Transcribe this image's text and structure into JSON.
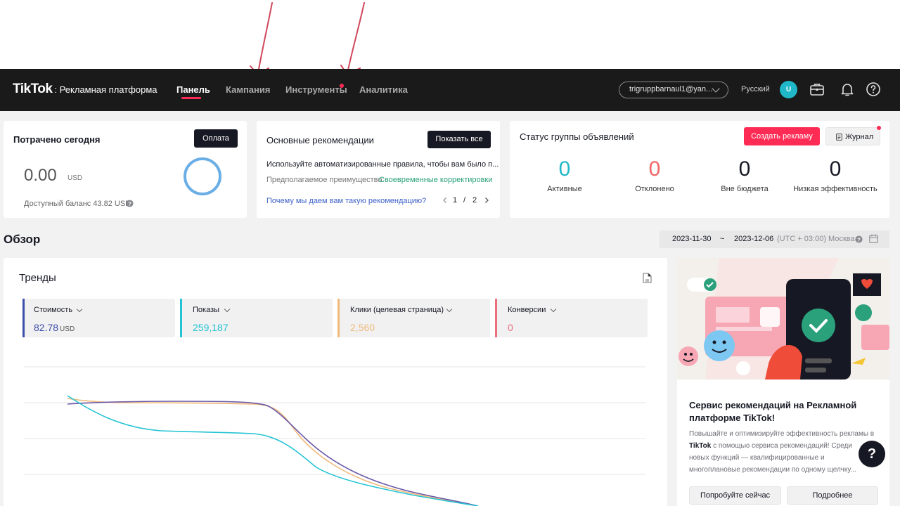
{
  "header": {
    "logo": "TikTok",
    "logo_sub": ": Рекламная платформа",
    "nav": [
      {
        "label": "Панель",
        "active": true
      },
      {
        "label": "Кампания",
        "active": false
      },
      {
        "label": "Инструменты",
        "active": false
      },
      {
        "label": "Аналитика",
        "active": false
      }
    ],
    "email": "trigruppbarnaul1@yan...",
    "language": "Русский",
    "avatar_letter": "U",
    "icons": [
      "briefcase-icon",
      "bell-icon",
      "help-icon"
    ]
  },
  "spent_card": {
    "title": "Потрачено сегодня",
    "pay_button": "Оплата",
    "amount": "0.00",
    "currency": "USD",
    "balance_text": "Доступный баланс 43.82 USD"
  },
  "recommendations": {
    "title": "Основные рекомендации",
    "show_all": "Показать все",
    "text": "Используйте автоматизированные правила, чтобы вам было п...",
    "benefit_label": "Предполагаемое преимущество:",
    "benefit_value": "Своевременные корректировки",
    "why_link": "Почему мы даем вам такую рекомендацию?",
    "page_current": "1",
    "page_sep": "/",
    "page_total": "2"
  },
  "adgroup_status": {
    "title": "Статус группы объявлений",
    "create_button": "Создать рекламу",
    "journal_button": "Журнал",
    "stats": [
      {
        "value": "0",
        "label": "Активные",
        "color": "#20b8c8"
      },
      {
        "value": "0",
        "label": "Отклонено",
        "color": "#f16464"
      },
      {
        "value": "0",
        "label": "Вне бюджета",
        "color": "#161823"
      },
      {
        "value": "0",
        "label": "Низкая эффективность",
        "color": "#161823"
      }
    ]
  },
  "overview": {
    "title": "Обзор",
    "date_from": "2023-11-30",
    "date_sep": "~",
    "date_to": "2023-12-06",
    "timezone": "(UTC + 03:00) Москва"
  },
  "trends": {
    "title": "Тренды",
    "metrics": [
      {
        "label": "Стоимость",
        "value": "82.78",
        "unit": "USD",
        "color": "#3d4fa8"
      },
      {
        "label": "Показы",
        "value": "259,187",
        "unit": "",
        "color": "#25c4d4"
      },
      {
        "label": "Клики (целевая страница)",
        "value": "2,560",
        "unit": "",
        "color": "#f0b97a"
      },
      {
        "label": "Конверсии",
        "value": "0",
        "unit": "",
        "color": "#e8707c"
      }
    ]
  },
  "promo": {
    "title_line1": "Сервис рекомендаций на Рекламной",
    "title_line2": "платформе TikTok!",
    "body_line1": "Повышайте и оптимизируйте эффективность рекламы в",
    "body_line2_brand": "TikTok",
    "body_line2_rest": "с помощью сервиса рекомендаций! Среди",
    "body_line3": "новых функций — квалифицированные и",
    "body_line4": "многоплановые рекомендации по одному щелчку...",
    "try_button": "Попробуйте сейчас",
    "more_button": "Подробнее"
  },
  "help_fab": "?"
}
